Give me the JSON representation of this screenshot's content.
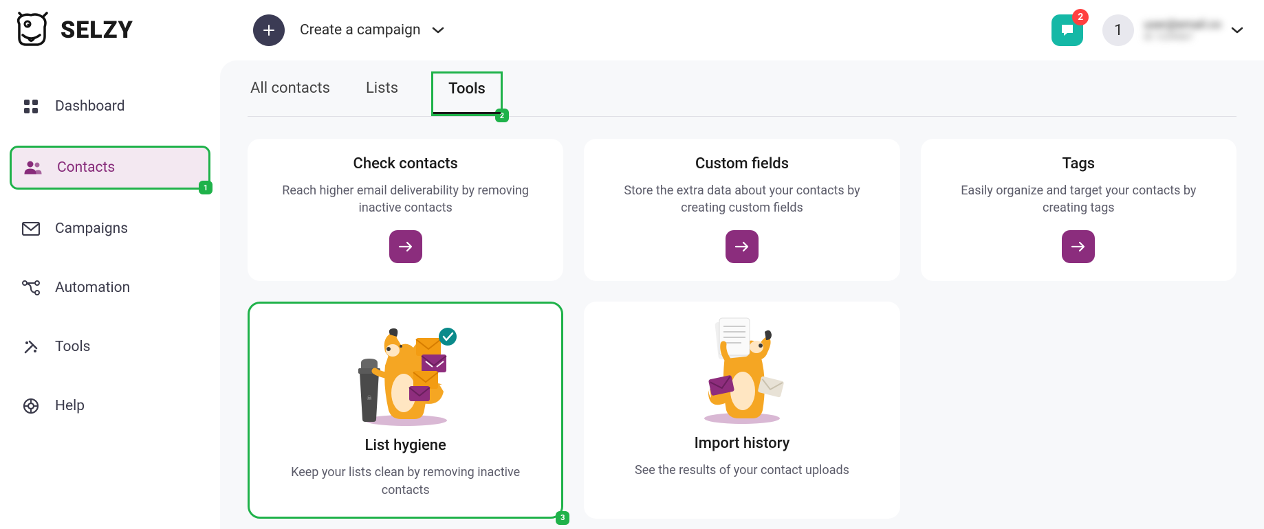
{
  "header": {
    "logo_text": "SELZY",
    "create_label": "Create a campaign",
    "chat_badge": "2",
    "avatar_initial": "1",
    "user_email": "user@email.co",
    "user_id": "ID 1234567"
  },
  "sidebar": {
    "items": [
      {
        "label": "Dashboard",
        "icon": "dashboard-icon"
      },
      {
        "label": "Contacts",
        "icon": "contacts-icon",
        "active": true,
        "step": "1"
      },
      {
        "label": "Campaigns",
        "icon": "campaigns-icon"
      },
      {
        "label": "Automation",
        "icon": "automation-icon"
      },
      {
        "label": "Tools",
        "icon": "tools-icon"
      },
      {
        "label": "Help",
        "icon": "help-icon"
      }
    ]
  },
  "tabs": {
    "items": [
      {
        "label": "All contacts"
      },
      {
        "label": "Lists"
      },
      {
        "label": "Tools",
        "active": true,
        "step": "2"
      }
    ]
  },
  "cards": {
    "row1": [
      {
        "title": "Check contacts",
        "desc": "Reach higher email deliverability by removing inactive contacts"
      },
      {
        "title": "Custom fields",
        "desc": "Store the extra data about your contacts by creating custom fields"
      },
      {
        "title": "Tags",
        "desc": "Easily organize and target your contacts by creating tags"
      }
    ],
    "row2": [
      {
        "title": "List hygiene",
        "desc": "Keep your lists clean by removing inactive contacts",
        "step": "3"
      },
      {
        "title": "Import history",
        "desc": "See the results of your contact uploads"
      }
    ]
  },
  "colors": {
    "accent": "#8b2d7d",
    "highlight": "#1fb24a",
    "teal": "#15b8a6",
    "badge": "#ff4040"
  }
}
